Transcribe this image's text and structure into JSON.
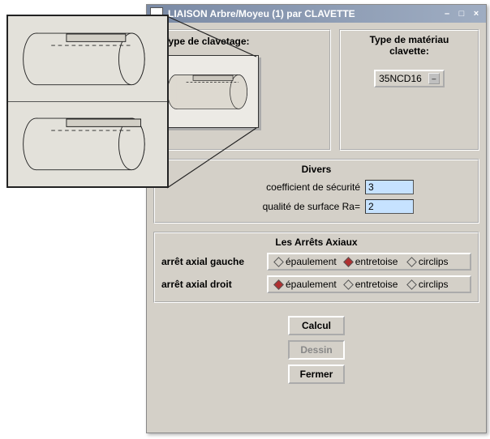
{
  "window": {
    "title": "LIAISON Arbre/Moyeu (1) par CLAVETTE"
  },
  "clavetage": {
    "title": "Type de clavetage:"
  },
  "materiau": {
    "title": "Type de matériau clavette:",
    "value": "35NCD16"
  },
  "divers": {
    "title": "Divers",
    "coef_label": "coefficient de sécurité",
    "coef_value": "3",
    "ra_label": "qualité de surface Ra=",
    "ra_value": "2"
  },
  "arrets": {
    "title": "Les Arrêts Axiaux",
    "gauche_label": "arrêt axial gauche",
    "droit_label": "arrêt axial droit",
    "options": {
      "ep": "épaulement",
      "en": "entretoise",
      "ci": "circlips"
    },
    "gauche_selected": "entretoise",
    "droit_selected": "épaulement"
  },
  "buttons": {
    "calcul": "Calcul",
    "dessin": "Dessin",
    "fermer": "Fermer"
  }
}
